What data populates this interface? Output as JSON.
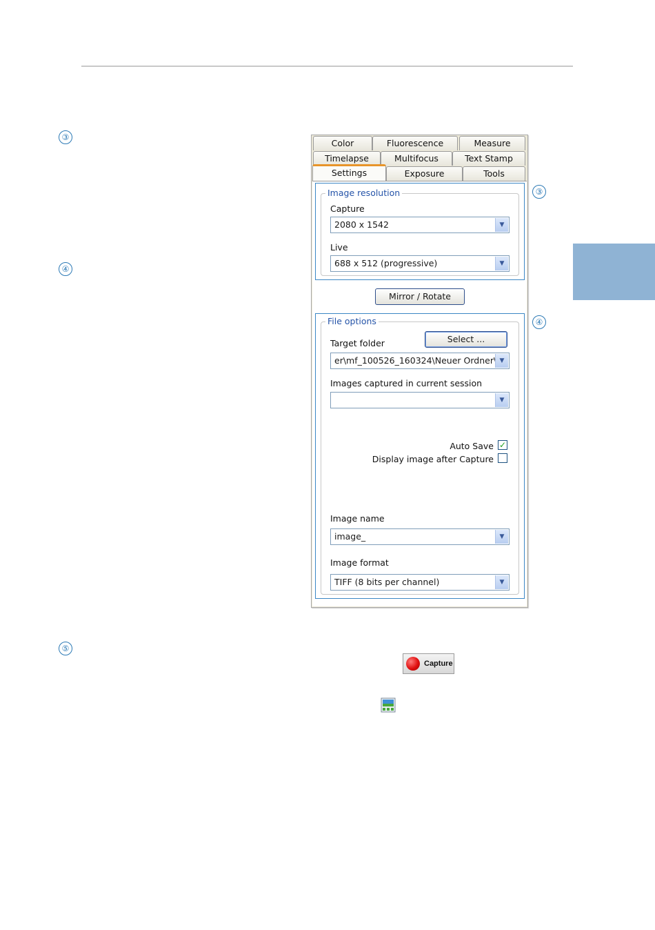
{
  "markers": {
    "three": "③",
    "four": "④",
    "five": "⑤"
  },
  "tabs": {
    "row1": [
      "Color",
      "Fluorescence",
      "Measure"
    ],
    "row2": [
      "Timelapse",
      "Multifocus",
      "Text Stamp"
    ],
    "row3": [
      "Settings",
      "Exposure",
      "Tools"
    ],
    "active": "Settings"
  },
  "image_resolution": {
    "legend": "Image resolution",
    "capture_label": "Capture",
    "capture_value": "2080 x 1542",
    "live_label": "Live",
    "live_value": "688 x 512 (progressive)"
  },
  "mirror_button": "Mirror / Rotate",
  "file_options": {
    "legend": "File options",
    "target_folder_label": "Target folder",
    "select_button": "Select ...",
    "target_folder_value": "er\\mf_100526_160324\\Neuer Ordner\\",
    "images_session_label": "Images captured in current session",
    "images_session_value": "",
    "auto_save_label": "Auto Save",
    "auto_save_checked": true,
    "display_after_label": "Display image after Capture",
    "display_after_checked": false,
    "image_name_label": "Image name",
    "image_name_value": "image_",
    "image_format_label": "Image format",
    "image_format_value": "TIFF (8 bits per channel)"
  },
  "capture_button": {
    "label": "Capture",
    "icon": "record-icon"
  },
  "image_view_icon": "image-gallery-icon",
  "colors": {
    "accent_blue": "#2b79b5",
    "side_tab": "#8fb3d4",
    "active_tab_line": "#e8952a"
  }
}
